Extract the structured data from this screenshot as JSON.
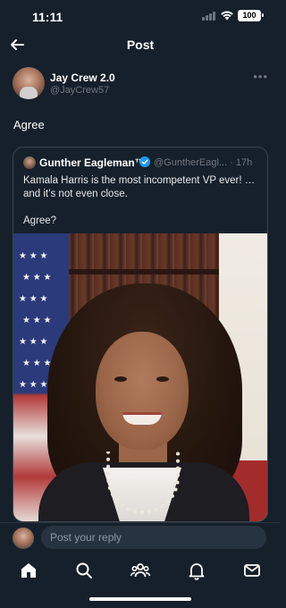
{
  "status": {
    "time": "11:11",
    "battery": "100"
  },
  "header": {
    "title": "Post"
  },
  "post": {
    "author_name": "Jay Crew 2.0",
    "author_handle": "@JayCrew57",
    "text": "Agree"
  },
  "quote": {
    "author_name": "Gunther Eagleman™",
    "author_handle": "@GuntherEagl...",
    "time": "· 17h",
    "text": "Kamala Harris is the most incompetent VP ever!  … and it’s not even close.\n\nAgree?"
  },
  "reply": {
    "placeholder": "Post your reply"
  },
  "colors": {
    "background": "#15202b",
    "accent": "#1d9bf0",
    "muted": "#71767b"
  },
  "icons": [
    "back-arrow-icon",
    "more-icon",
    "verified-badge-icon",
    "home-icon",
    "search-icon",
    "communities-icon",
    "notifications-icon",
    "messages-icon"
  ]
}
